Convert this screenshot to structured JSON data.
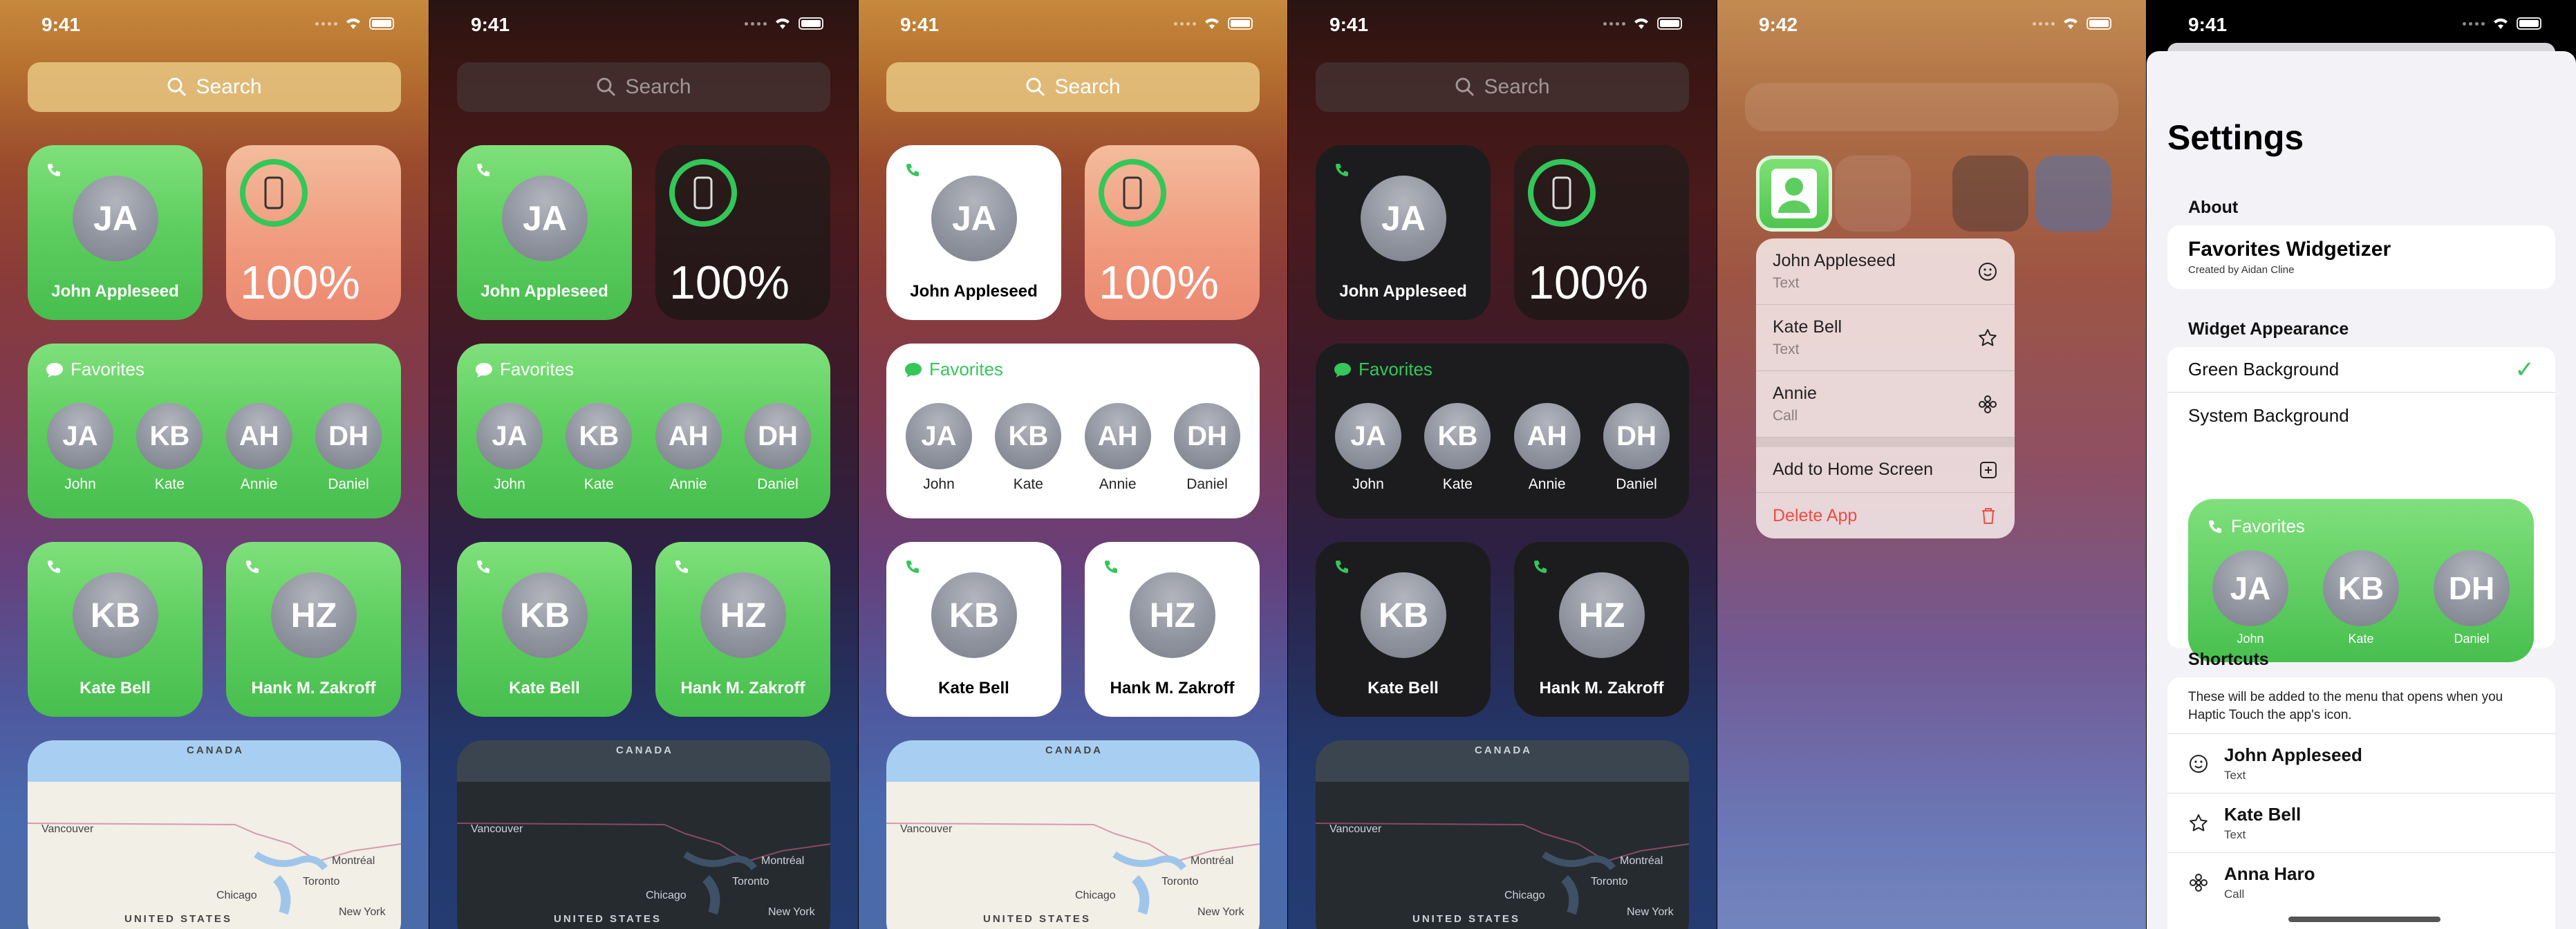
{
  "status": {
    "time1": "9:41",
    "time2": "9:41",
    "time3": "9:41",
    "time4": "9:41",
    "time5": "9:42",
    "time6": "9:41"
  },
  "search": {
    "placeholder": "Search"
  },
  "widgets": {
    "contact1": {
      "initials": "JA",
      "name": "John Appleseed"
    },
    "battery": {
      "percent": "100%"
    },
    "favorites": {
      "title": "Favorites",
      "people": [
        {
          "initials": "JA",
          "label": "John"
        },
        {
          "initials": "KB",
          "label": "Kate"
        },
        {
          "initials": "AH",
          "label": "Annie"
        },
        {
          "initials": "DH",
          "label": "Daniel"
        }
      ]
    },
    "contact2": {
      "initials": "KB",
      "name": "Kate Bell"
    },
    "contact3": {
      "initials": "HZ",
      "name": "Hank M. Zakroff"
    }
  },
  "map": {
    "canada": "CANADA",
    "usa": "UNITED STATES",
    "vancouver": "Vancouver",
    "montreal": "Montréal",
    "toronto": "Toronto",
    "chicago": "Chicago",
    "newyork": "New York"
  },
  "context_menu": {
    "items": [
      {
        "title": "John Appleseed",
        "subtitle": "Text",
        "icon": "smiley-icon"
      },
      {
        "title": "Kate Bell",
        "subtitle": "Text",
        "icon": "star-icon"
      },
      {
        "title": "Annie",
        "subtitle": "Call",
        "icon": "flower-icon"
      }
    ],
    "add_home": "Add to Home Screen",
    "delete": "Delete App"
  },
  "settings": {
    "title": "Settings",
    "about_header": "About",
    "app_name": "Favorites Widgetizer",
    "app_credit": "Created by Aidan Cline",
    "appearance_header": "Widget Appearance",
    "option_green": "Green Background",
    "option_system": "System Background",
    "check": "✓",
    "preview": {
      "title": "Favorites",
      "people": [
        {
          "initials": "JA",
          "label": "John"
        },
        {
          "initials": "KB",
          "label": "Kate"
        },
        {
          "initials": "DH",
          "label": "Daniel"
        }
      ]
    },
    "shortcuts_header": "Shortcuts",
    "shortcuts_desc": "These will be added to the menu that opens when you Haptic Touch the app's icon.",
    "shortcuts": [
      {
        "name": "John Appleseed",
        "type": "Text",
        "icon": "smiley-icon"
      },
      {
        "name": "Kate Bell",
        "type": "Text",
        "icon": "star-icon"
      },
      {
        "name": "Anna Haro",
        "type": "Call",
        "icon": "flower-icon"
      }
    ]
  },
  "colors": {
    "accent_green": "#34c759",
    "delete_red": "#ec4d42"
  }
}
